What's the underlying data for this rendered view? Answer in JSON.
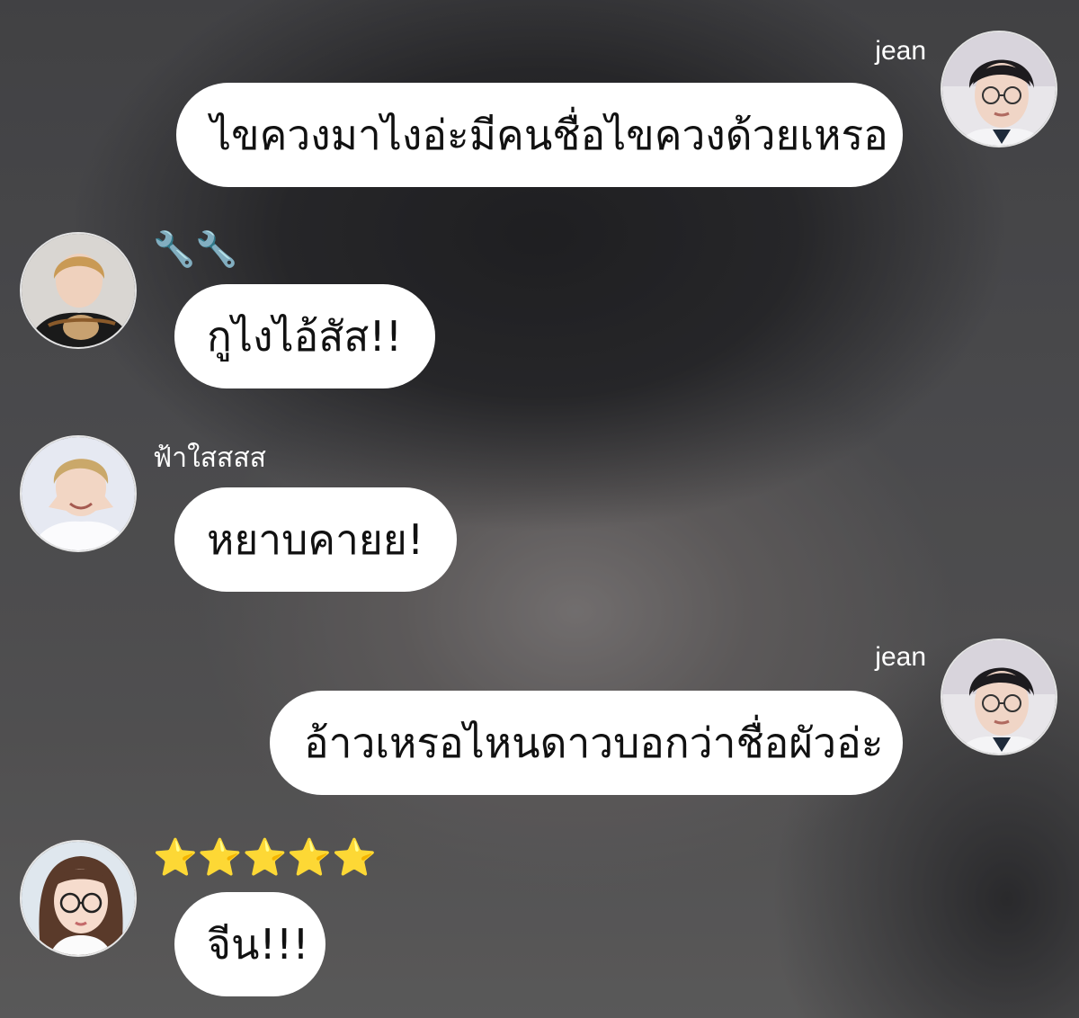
{
  "messages": [
    {
      "side": "right",
      "sender": "jean",
      "text": "ไขควงมาไงอ่ะมีคนชื่อไขควงด้วยเหรอ",
      "avatar_icon": "user-avatar-glasses-boy"
    },
    {
      "side": "left",
      "sender": "🔧🔧",
      "text": "กูไงไอ้สัส!!",
      "avatar_icon": "user-avatar-blond-boy"
    },
    {
      "side": "left",
      "sender": "ฟ้าใสสสส",
      "text": "หยาบคายย!",
      "avatar_icon": "user-avatar-smiling-boy"
    },
    {
      "side": "right",
      "sender": "jean",
      "text": "อ้าวเหรอไหนดาวบอกว่าชื่อผัวอ่ะ",
      "avatar_icon": "user-avatar-glasses-boy"
    },
    {
      "side": "left",
      "sender": "⭐⭐⭐⭐⭐",
      "text": "จีน!!!",
      "avatar_icon": "user-avatar-girl-glasses"
    }
  ],
  "colors": {
    "bubble": "#ffffff",
    "bubble_text": "#111111",
    "name_text": "#ffffff"
  }
}
